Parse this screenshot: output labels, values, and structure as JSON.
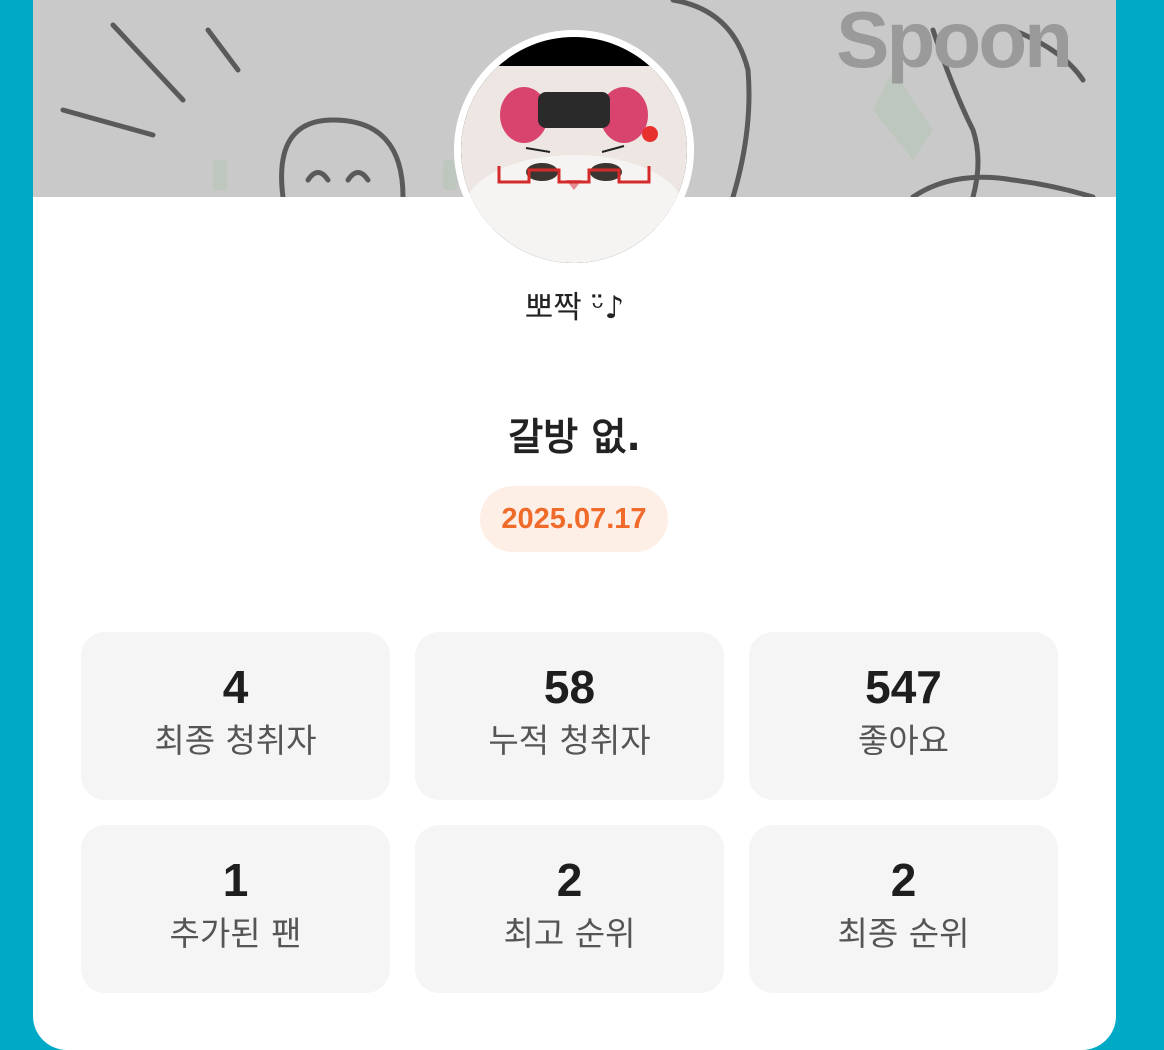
{
  "banner": {
    "brand": "Spoon"
  },
  "profile": {
    "nickname": "뽀짝 ᵕ̈♪",
    "avatar_icon": "cat-photo"
  },
  "live": {
    "title": "갈방 없.",
    "date": "2025.07.17"
  },
  "stats": [
    {
      "value": "4",
      "label": "최종 청취자"
    },
    {
      "value": "58",
      "label": "누적 청취자"
    },
    {
      "value": "547",
      "label": "좋아요"
    },
    {
      "value": "1",
      "label": "추가된 팬"
    },
    {
      "value": "2",
      "label": "최고 순위"
    },
    {
      "value": "2",
      "label": "최종 순위"
    }
  ],
  "colors": {
    "background": "#00a9c6",
    "date_text": "#f06a2a",
    "date_badge": "#fdeee6"
  }
}
